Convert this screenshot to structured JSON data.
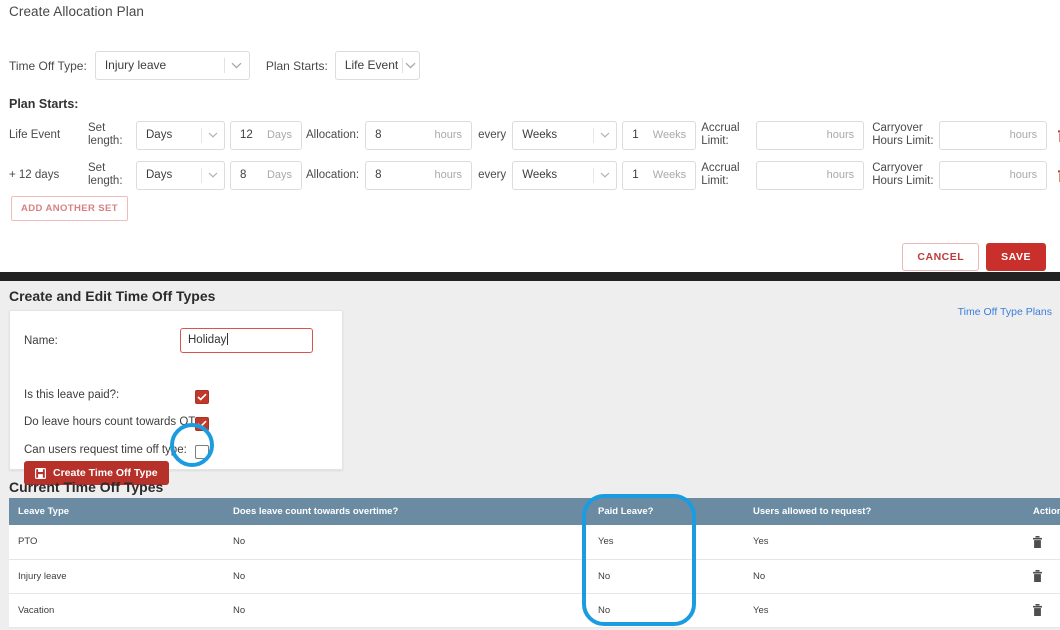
{
  "top_panel": {
    "title": "Create Allocation Plan",
    "filters": {
      "time_off_type_label": "Time Off Type:",
      "time_off_type_value": "Injury leave",
      "plan_starts_label": "Plan Starts:",
      "plan_starts_value": "Life Event"
    },
    "plan_starts_heading": "Plan Starts:",
    "labels": {
      "set_length": "Set\nlength:",
      "allocation": "Allocation:",
      "every": "every",
      "accrual_limit": "Accrual\nLimit:",
      "carryover_hours_limit": "Carryover\nHours Limit:"
    },
    "rows": [
      {
        "name": "Life Event",
        "length_unit": "Days",
        "length_value": "12",
        "length_unit_suffix": "Days",
        "allocation_value": "8",
        "allocation_unit": "hours",
        "period_unit": "Weeks",
        "period_value": "1",
        "period_unit_suffix": "Weeks",
        "accrual_limit_value": "",
        "accrual_limit_placeholder": "hours",
        "carryover_value": "",
        "carryover_placeholder": "hours"
      },
      {
        "name": "+ 12 days",
        "length_unit": "Days",
        "length_value": "8",
        "length_unit_suffix": "Days",
        "allocation_value": "8",
        "allocation_unit": "hours",
        "period_unit": "Weeks",
        "period_value": "1",
        "period_unit_suffix": "Weeks",
        "accrual_limit_value": "",
        "accrual_limit_placeholder": "hours",
        "carryover_value": "",
        "carryover_placeholder": "hours"
      }
    ],
    "add_another_set": "ADD ANOTHER SET",
    "cancel": "CANCEL",
    "save": "SAVE"
  },
  "bottom_panel": {
    "create_heading": "Create and Edit Time Off Types",
    "time_off_type_plans_link": "Time Off Type Plans",
    "form": {
      "name_label": "Name:",
      "name_value": "Holiday",
      "paid_label": "Is this leave paid?:",
      "paid_checked": true,
      "ot_label": "Do leave hours count towards OT:",
      "ot_checked": true,
      "request_label": "Can users request time off type:",
      "request_checked": false,
      "create_button": "Create Time Off Type"
    },
    "current_heading": "Current Time Off Types",
    "table": {
      "columns": [
        "Leave Type",
        "Does leave count towards overtime?",
        "Paid Leave?",
        "Users allowed to request?",
        "Actions"
      ],
      "rows": [
        {
          "leave_type": "PTO",
          "overtime": "No",
          "paid": "Yes",
          "requestable": "Yes"
        },
        {
          "leave_type": "Injury leave",
          "overtime": "No",
          "paid": "No",
          "requestable": "No"
        },
        {
          "leave_type": "Vacation",
          "overtime": "No",
          "paid": "No",
          "requestable": "Yes"
        }
      ]
    }
  },
  "colors": {
    "accent_red": "#c9302c",
    "annotation_blue": "#1b9ce0",
    "table_header": "#6b8ba3",
    "link_blue": "#3b7ddd"
  }
}
